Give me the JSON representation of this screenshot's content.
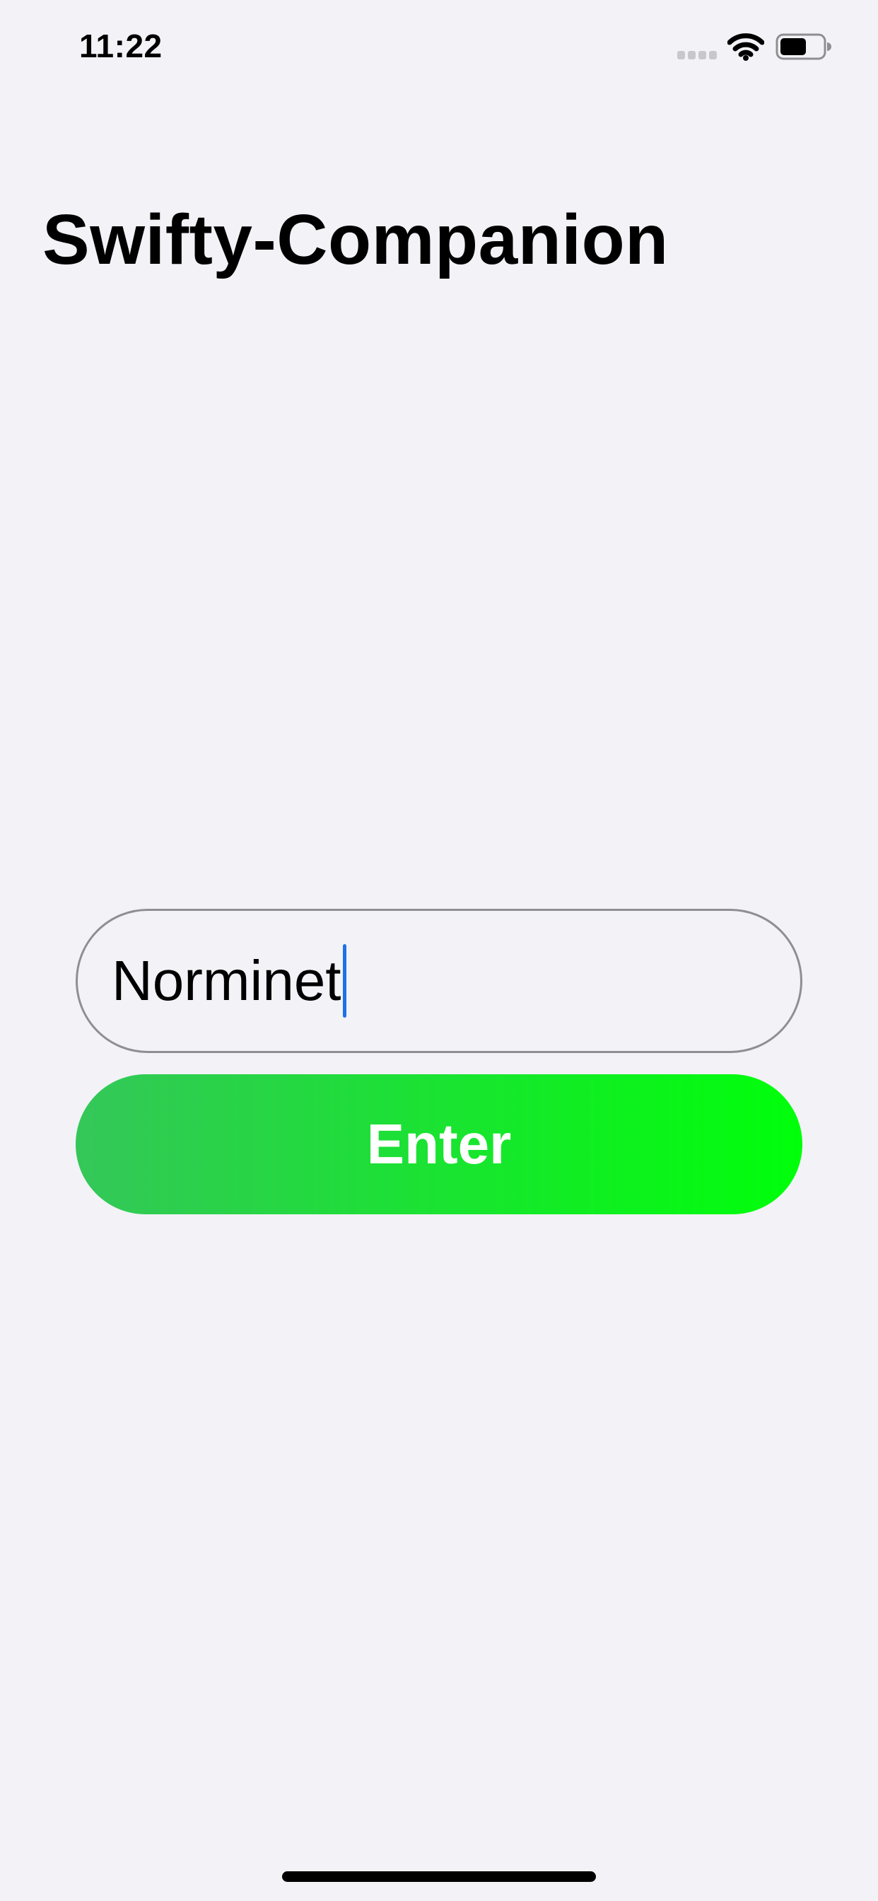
{
  "status_bar": {
    "time": "11:22",
    "icons": [
      "cellular-signal-icon",
      "wifi-icon",
      "battery-icon"
    ]
  },
  "header": {
    "title": "Swifty-Companion"
  },
  "login": {
    "username_value": "Norminet",
    "enter_label": "Enter"
  },
  "colors": {
    "background": "#F2F2F7",
    "button_gradient_start": "#34C759",
    "button_gradient_end": "#00FF0A",
    "field_border": "#8E8E93",
    "cursor": "#1E72E8"
  }
}
